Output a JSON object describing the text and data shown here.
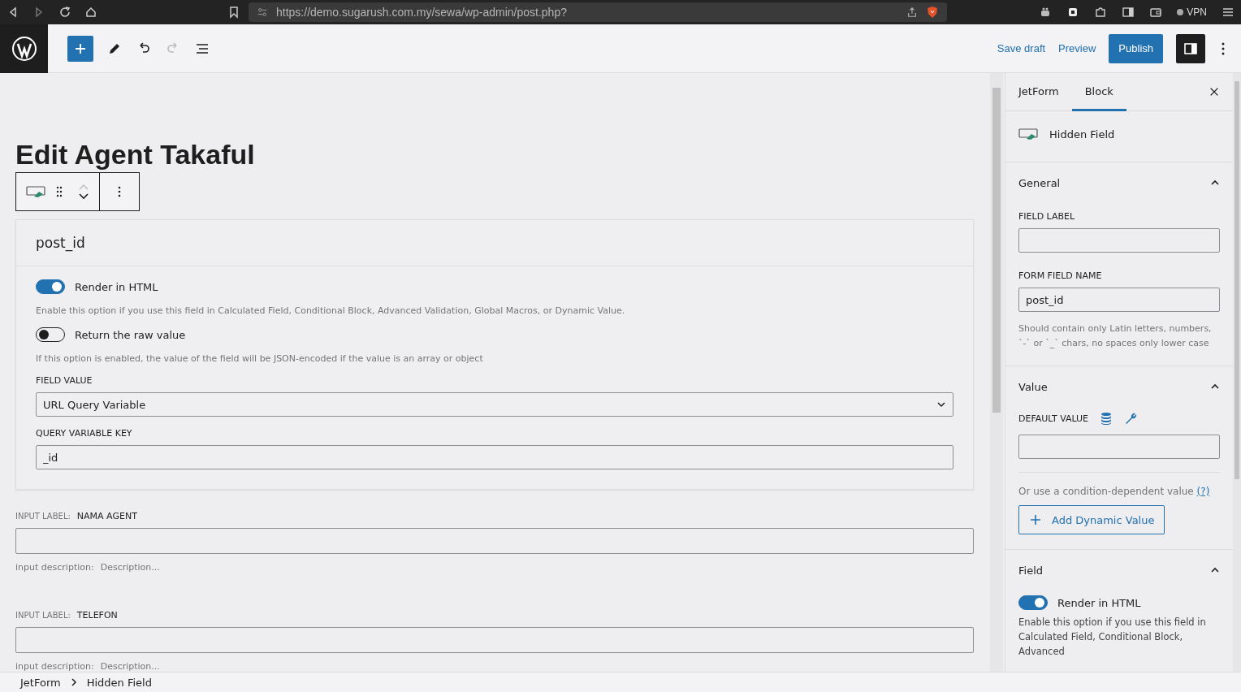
{
  "browser": {
    "url": "https://demo.sugarush.com.my/sewa/wp-admin/post.php?",
    "vpn_label": "VPN"
  },
  "toolbar": {
    "redo_disabled": true,
    "save_draft": "Save draft",
    "preview": "Preview",
    "publish": "Publish",
    "settings_selected": true
  },
  "post_title": "Edit Agent Takaful",
  "block": {
    "name": "post_id",
    "toggles": [
      {
        "label": "Render in HTML",
        "on": true,
        "help": "Enable this option if you use this field in Calculated Field, Conditional Block, Advanced Validation, Global Macros, or Dynamic Value."
      },
      {
        "label": "Return the raw value",
        "on": false,
        "help": "If this option is enabled, the value of the field will be JSON-encoded if the value is an array or object"
      }
    ],
    "field_value": {
      "label": "FIELD VALUE",
      "value": "URL Query Variable"
    },
    "query_key": {
      "label": "QUERY VARIABLE KEY",
      "value": "_id"
    }
  },
  "other_fields": [
    {
      "label_caption": "INPUT LABEL:",
      "label": "NAMA AGENT",
      "description_caption": "input description:",
      "description_placeholder": "Description..."
    },
    {
      "label_caption": "INPUT LABEL:",
      "label": "TELEFON",
      "description_caption": "input description:",
      "description_placeholder": "Description..."
    }
  ],
  "sidebar": {
    "tabs": [
      {
        "label": "JetForm",
        "selected": false
      },
      {
        "label": "Block",
        "selected": true
      }
    ],
    "block_name": "Hidden Field",
    "general": {
      "title": "General",
      "expanded": true,
      "field_label": {
        "label": "FIELD LABEL"
      },
      "field_name": {
        "label": "FORM FIELD NAME",
        "value": "post_id",
        "help": "Should contain only Latin letters, numbers, `-` or `_` chars, no spaces only lower case"
      }
    },
    "value": {
      "title": "Value",
      "expanded": true,
      "default_label": "DEFAULT VALUE",
      "condition_text": "Or use a condition-dependent value",
      "help_link": "(?)",
      "add_button": "Add Dynamic Value"
    },
    "field": {
      "title": "Field",
      "expanded": true,
      "toggle": {
        "label": "Render in HTML",
        "on": true
      },
      "help": "Enable this option if you use this field in Calculated Field, Conditional Block, Advanced"
    }
  },
  "breadcrumb": [
    "JetForm",
    "Hidden Field"
  ]
}
